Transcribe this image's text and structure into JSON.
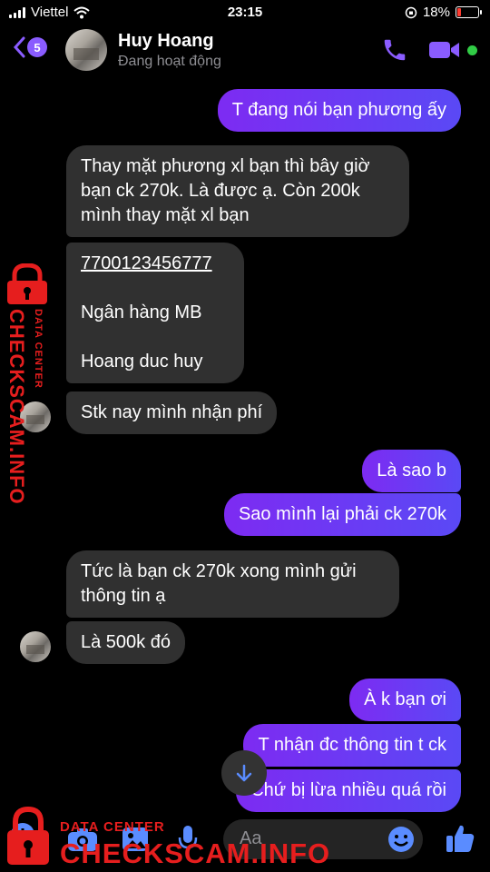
{
  "status_bar": {
    "carrier": "Viettel",
    "time": "23:15",
    "battery_text": "18%",
    "battery_level": 0.18
  },
  "header": {
    "unread_count": "5",
    "contact_name": "Huy Hoang",
    "presence": "Đang hoạt động"
  },
  "messages": [
    {
      "dir": "out",
      "text": "T đang nói bạn phương ấy"
    },
    {
      "dir": "in",
      "text": "Thay mặt phương xl bạn thì bây giờ\nbạn ck 270k. Là được ạ. Còn 200k\nmình thay mặt xl bạn"
    },
    {
      "dir": "in",
      "account_number": "7700123456777",
      "bank": "Ngân hàng MB",
      "holder": "Hoang duc huy"
    },
    {
      "dir": "in",
      "text": "Stk nay mình nhận phí"
    },
    {
      "dir": "out",
      "text": "Là sao b"
    },
    {
      "dir": "out",
      "text": "Sao mình lại phải ck 270k"
    },
    {
      "dir": "in",
      "text": "Tức là bạn ck 270k xong mình gửi\nthông tin ạ"
    },
    {
      "dir": "in",
      "text": "Là 500k đó"
    },
    {
      "dir": "out",
      "text": "À k bạn ơi"
    },
    {
      "dir": "out",
      "text": "T nhận đc thông tin t ck"
    },
    {
      "dir": "out",
      "text": "Chứ bị lừa nhiều quá rồi"
    }
  ],
  "composer": {
    "placeholder": "Aa"
  },
  "watermark": {
    "small": "DATA CENTER",
    "large": "CHECKSCAM.INFO"
  },
  "colors": {
    "accent": "#8a5cff",
    "outgoing_start": "#7d2bf2",
    "outgoing_end": "#5a49f5",
    "incoming": "#303030",
    "watermark": "#e61e1e",
    "online": "#31cc46"
  },
  "icons": [
    "back-chevron-icon",
    "phone-icon",
    "video-camera-icon",
    "camera-icon",
    "image-icon",
    "microphone-icon",
    "emoji-icon",
    "thumbs-up-icon",
    "arrow-down-icon",
    "padlock-icon"
  ]
}
